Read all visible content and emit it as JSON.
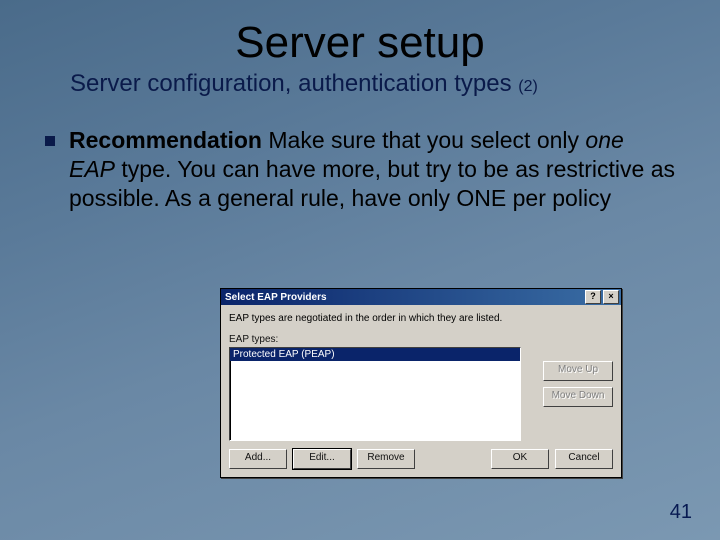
{
  "slide": {
    "title": "Server setup",
    "subtitle_main": "Server configuration, authentication types ",
    "subtitle_num": "(2)",
    "bullet_bold": "Recommendation",
    "bullet_rest_1": " Make sure that you select only ",
    "bullet_italic": "one EAP",
    "bullet_rest_2": " type. You can have more, but try to be as restrictive as possible. As a general rule, have only ONE per policy",
    "page_number": "41"
  },
  "dialog": {
    "title": "Select EAP Providers",
    "help_btn": "?",
    "close_btn": "×",
    "instruction": "EAP types are negotiated in the order in which they are listed.",
    "list_label": "EAP types:",
    "list_items": [
      "Protected EAP (PEAP)"
    ],
    "buttons": {
      "move_up": "Move Up",
      "move_down": "Move Down",
      "add": "Add...",
      "edit": "Edit...",
      "remove": "Remove",
      "ok": "OK",
      "cancel": "Cancel"
    }
  }
}
